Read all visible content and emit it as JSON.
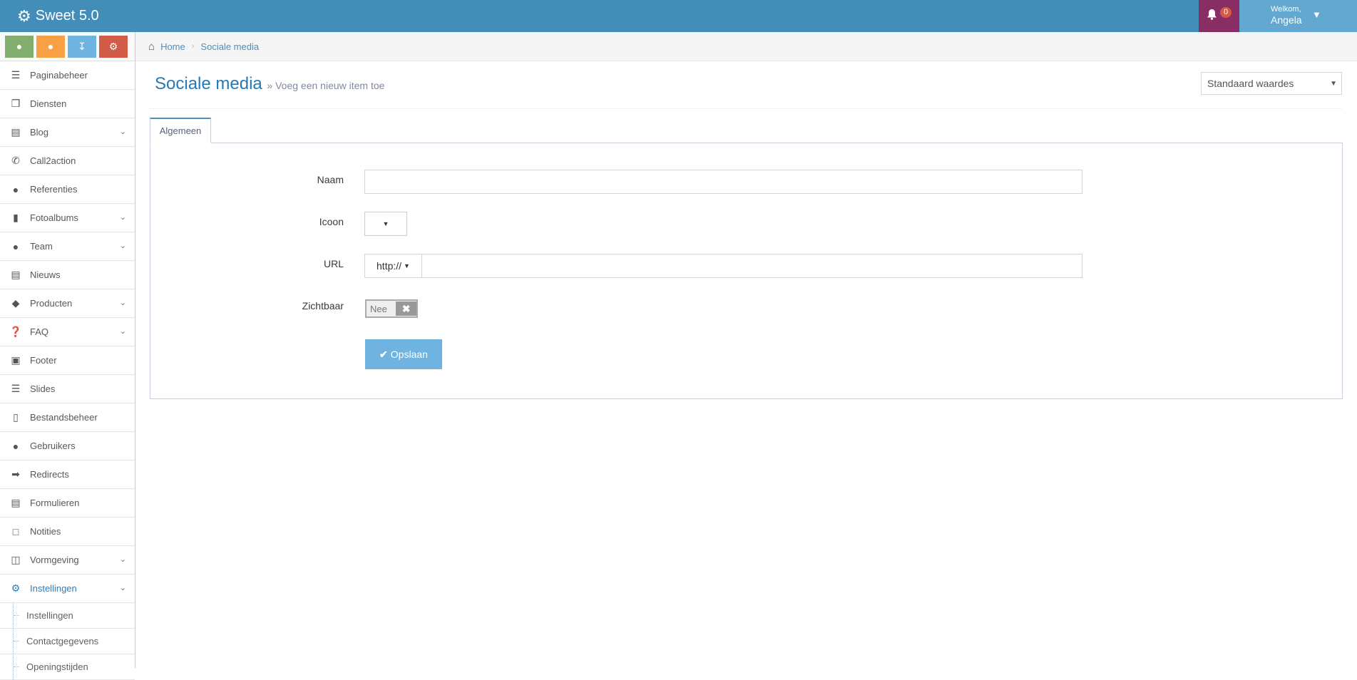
{
  "app": {
    "title": "Sweet 5.0",
    "logo_icon": "cogs-icon"
  },
  "topbar": {
    "notifications_count": "0",
    "welcome": "Welkom,",
    "user_name": "Angela"
  },
  "shortcuts": [
    {
      "icon": "map-marker-icon",
      "color": "#82af6f"
    },
    {
      "icon": "user-icon",
      "color": "#f8a046"
    },
    {
      "icon": "download-icon",
      "color": "#6fb3e0"
    },
    {
      "icon": "cogs-icon",
      "color": "#d15b47"
    }
  ],
  "sidebar": {
    "items": [
      {
        "label": "Paginabeheer",
        "icon": "list-icon",
        "chevron": false
      },
      {
        "label": "Diensten",
        "icon": "cubes-icon",
        "chevron": false
      },
      {
        "label": "Blog",
        "icon": "file-text-icon",
        "chevron": true
      },
      {
        "label": "Call2action",
        "icon": "phone-volume-icon",
        "chevron": false
      },
      {
        "label": "Referenties",
        "icon": "comments-icon",
        "chevron": false
      },
      {
        "label": "Fotoalbums",
        "icon": "book-icon",
        "chevron": true
      },
      {
        "label": "Team",
        "icon": "users-icon",
        "chevron": true
      },
      {
        "label": "Nieuws",
        "icon": "newspaper-icon",
        "chevron": false
      },
      {
        "label": "Producten",
        "icon": "tags-icon",
        "chevron": true
      },
      {
        "label": "FAQ",
        "icon": "question-circle-icon",
        "chevron": true
      },
      {
        "label": "Footer",
        "icon": "window-icon",
        "chevron": false
      },
      {
        "label": "Slides",
        "icon": "sliders-icon",
        "chevron": false
      },
      {
        "label": "Bestandsbeheer",
        "icon": "folder-open-icon",
        "chevron": false
      },
      {
        "label": "Gebruikers",
        "icon": "user-icon",
        "chevron": false
      },
      {
        "label": "Redirects",
        "icon": "arrow-circle-right-icon",
        "chevron": false
      },
      {
        "label": "Formulieren",
        "icon": "form-icon",
        "chevron": false
      },
      {
        "label": "Notities",
        "icon": "sticky-note-icon",
        "chevron": false
      },
      {
        "label": "Vormgeving",
        "icon": "layout-icon",
        "chevron": true
      },
      {
        "label": "Instellingen",
        "icon": "gear-icon",
        "chevron": true,
        "active": true
      }
    ],
    "subitems": [
      {
        "label": "Instellingen"
      },
      {
        "label": "Contactgegevens"
      },
      {
        "label": "Openingstijden"
      }
    ],
    "active_color": "#2b7dbc"
  },
  "breadcrumb": {
    "home": "Home",
    "current": "Sociale media"
  },
  "page": {
    "title": "Sociale media",
    "subtitle": "Voeg een nieuw item toe",
    "select_value": "Standaard waardes"
  },
  "tabs": [
    {
      "label": "Algemeen",
      "active": true
    }
  ],
  "form": {
    "naam_label": "Naam",
    "naam_value": "",
    "icoon_label": "Icoon",
    "url_label": "URL",
    "url_prefix": "http://",
    "url_value": "",
    "zichtbaar_label": "Zichtbaar",
    "zichtbaar_value": "Nee",
    "save_label": "Opslaan"
  },
  "colors": {
    "topbar": "#438eb9",
    "notifications": "#892e65",
    "user": "#62a8d1",
    "save_button": "#6fb3e0"
  }
}
